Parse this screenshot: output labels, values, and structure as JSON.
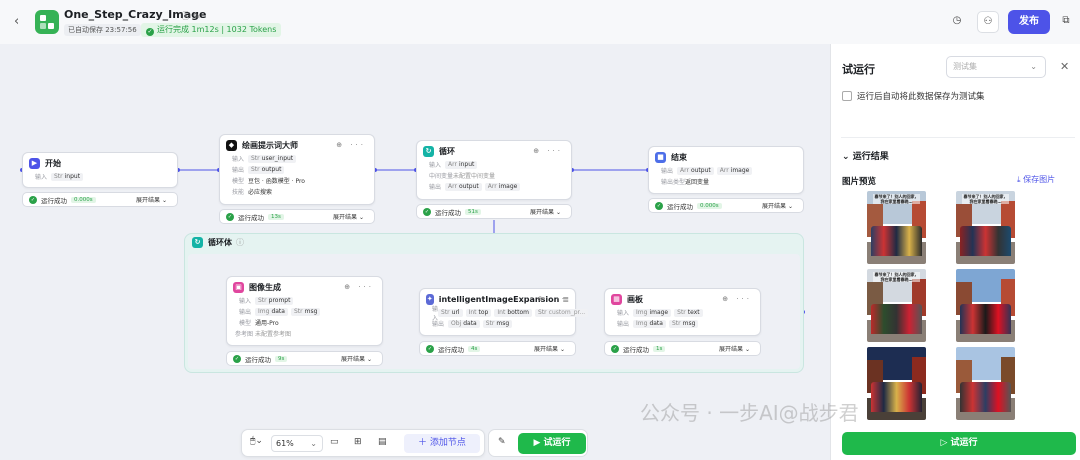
{
  "header": {
    "app_title": "One_Step_Crazy_Image",
    "autosave": "已自动保存 23:57:56",
    "run_status": "运行完成 1m12s | 1032 Tokens",
    "publish_label": "发布"
  },
  "nodes": {
    "start": {
      "title": "开始",
      "input_label": "输入",
      "input_tag": "input",
      "status": "运行成功",
      "time": "0.000s",
      "expand": "展开结果"
    },
    "prompt": {
      "title": "绘画提示词大师",
      "in_label": "输入",
      "in_tag": "user_input",
      "out_label": "输出",
      "out_tag": "output",
      "model_label": "模型",
      "model_value": "豆包 · 函数模型 · Pro",
      "skill_label": "技能",
      "skill_value": "必应搜索",
      "status": "运行成功",
      "time": "13s",
      "expand": "展开结果"
    },
    "loop": {
      "title": "循环",
      "in_label": "输入",
      "in_tag": "input",
      "mid_label": "中间变量",
      "mid_value": "未配置中间变量",
      "out_label": "输出",
      "out_tag1": "output",
      "out_tag2": "image",
      "status": "运行成功",
      "time": "51s",
      "expand": "展开结果"
    },
    "end": {
      "title": "结束",
      "out_label": "输出",
      "out_tag1": "output",
      "out_tag2": "image",
      "ret_label": "输出类型",
      "ret_value": "返回变量",
      "status": "运行成功",
      "time": "0.000s",
      "expand": "展开结果"
    },
    "loop_body": {
      "title": "循环体"
    },
    "image_gen": {
      "title": "图像生成",
      "in_label": "输入",
      "in_tag": "prompt",
      "out_label": "输出",
      "out_tag1": "data",
      "out_tag2": "msg",
      "model_label": "模型",
      "model_value": "通用-Pro",
      "ref_label": "参考图",
      "ref_value": "未配置参考图",
      "status": "运行成功",
      "time": "9s",
      "expand": "展开结果"
    },
    "expansion": {
      "title": "intelligentImageExpansion",
      "in_label": "输入",
      "in_tags": [
        "url",
        "top",
        "bottom",
        "custom_pr..."
      ],
      "out_label": "输出",
      "out_tag1": "data",
      "out_tag2": "msg",
      "status": "运行成功",
      "time": "4s",
      "expand": "展开结果"
    },
    "canvas": {
      "title": "画板",
      "in_label": "输入",
      "in_tag1": "image",
      "in_tag2": "text",
      "out_label": "输出",
      "out_tag1": "data",
      "out_tag2": "msg",
      "status": "运行成功",
      "time": "1s",
      "expand": "展开结果"
    }
  },
  "toolbar": {
    "zoom": "61%",
    "add_node": "添加节点",
    "run": "试运行"
  },
  "panel": {
    "title": "试运行",
    "testset_placeholder": "测试集",
    "save_checkbox": "运行后自动将此数据保存为测试集",
    "results_title": "运行结果",
    "preview_title": "图片预览",
    "save_images": "保存图片",
    "thumb_caption": "春节来了！别人的回家，我在家里看春晚…",
    "run_button": "试运行"
  },
  "watermark": "公众号 · 一步AI@战步君",
  "colors": {
    "accent": "#4d53e8",
    "success": "#1fb94b",
    "start_icon": "#4d53e8",
    "loop_icon": "#14b3a6",
    "image_icon": "#e0469e",
    "expansion_icon": "#5c6ad6",
    "end_icon": "#4d6ee8"
  }
}
